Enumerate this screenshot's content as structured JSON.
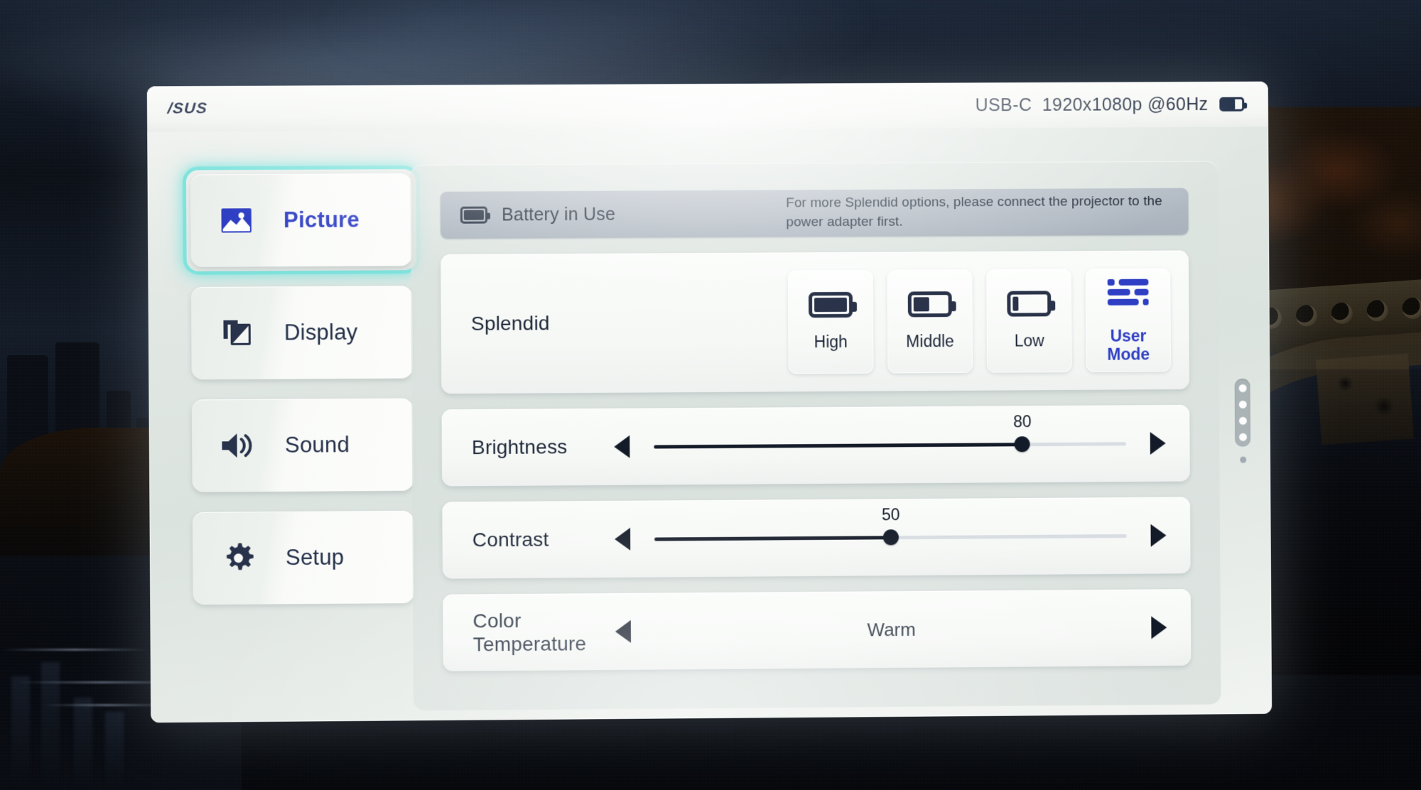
{
  "header": {
    "brand": "/SUS",
    "status": "USB-C  1920x1080p @60Hz",
    "battery_icon": "battery-icon"
  },
  "sidebar": {
    "items": [
      {
        "label": "Picture",
        "icon": "picture-icon",
        "selected": true
      },
      {
        "label": "Display",
        "icon": "display-icon",
        "selected": false
      },
      {
        "label": "Sound",
        "icon": "speaker-icon",
        "selected": false
      },
      {
        "label": "Setup",
        "icon": "gear-icon",
        "selected": false
      }
    ]
  },
  "banner": {
    "icon": "battery-in-use-icon",
    "title": "Battery in Use",
    "message": "For more Splendid options, please connect the projector to the power adapter first."
  },
  "splendid": {
    "label": "Splendid",
    "options": [
      {
        "label": "High",
        "icon": "battery-full-icon",
        "selected": false
      },
      {
        "label": "Middle",
        "icon": "battery-half-icon",
        "selected": false
      },
      {
        "label": "Low",
        "icon": "battery-low-icon",
        "selected": false
      },
      {
        "label": "User\nMode",
        "icon": "equalizer-icon",
        "selected": true
      }
    ]
  },
  "brightness": {
    "label": "Brightness",
    "value": "80",
    "percent": 78,
    "left_arrow": "arrow-left-icon",
    "right_arrow": "arrow-right-icon"
  },
  "contrast": {
    "label": "Contrast",
    "value": "50",
    "percent": 50,
    "left_arrow": "arrow-left-icon",
    "right_arrow": "arrow-right-icon"
  },
  "color_temperature": {
    "label": "Color\nTemperature",
    "value": "Warm",
    "left_arrow": "arrow-left-icon",
    "right_arrow": "arrow-right-icon"
  },
  "scroll_indicator": {
    "pages": 4,
    "current_page": 1
  },
  "colors": {
    "accent_blue": "#2f3fc4",
    "selection_glow": "#7fe3dd",
    "navy": "#1d2738",
    "banner_bg": "#aeb7c0",
    "panel_bg": "#e2e8e4"
  }
}
